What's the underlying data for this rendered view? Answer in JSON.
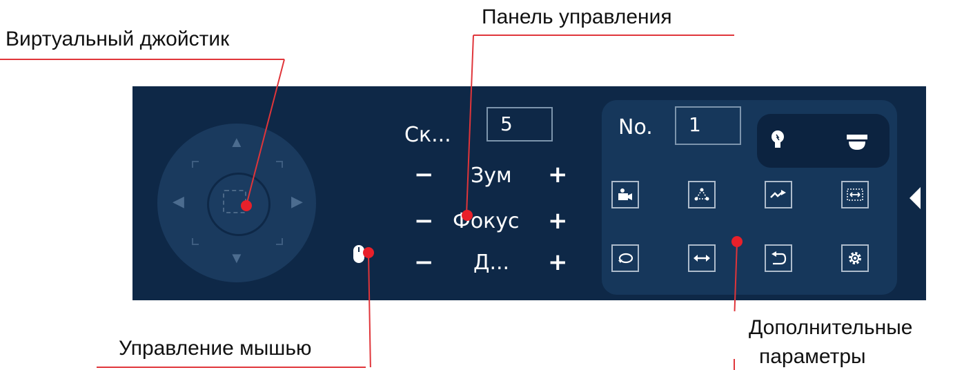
{
  "callouts": {
    "joystick": "Виртуальный джойстик",
    "control_panel": "Панель управления",
    "mouse": "Управление мышью",
    "extra_line1": "Дополнительные",
    "extra_line2": "параметры"
  },
  "panel": {
    "speed_label": "Ск...",
    "speed_value": "5",
    "zoom_label": "Зум",
    "focus_label": "Фокус",
    "iris_label": "Д...",
    "minus": "−",
    "plus": "+",
    "no_label": "No.",
    "no_value": "1"
  },
  "colors": {
    "panel_bg": "#0e2847",
    "callout_line": "#e0353a"
  },
  "icons": {
    "light": "lightbulb-icon",
    "wiper": "dome-camera-icon",
    "preset": "preset-camera-icon",
    "tour": "tour-nodes-icon",
    "pattern": "pattern-arrow-icon",
    "scan": "scan-icon",
    "rotate": "rotate-icon",
    "pan": "pan-arrows-icon",
    "flip": "flip-icon",
    "settings": "gear-icon"
  }
}
